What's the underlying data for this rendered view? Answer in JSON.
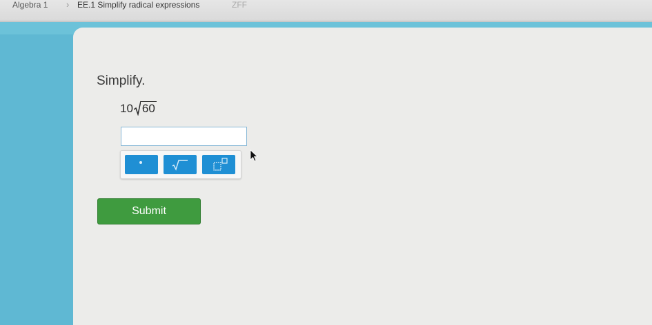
{
  "breadcrumb": {
    "subject": "Algebra 1",
    "skill": "EE.1 Simplify radical expressions",
    "code": "ZFF"
  },
  "question": {
    "title": "Simplify.",
    "coefficient": "10",
    "radicand": "60"
  },
  "answer": {
    "value": ""
  },
  "keypad": {
    "keys": [
      {
        "name": "decimal-point",
        "icon": "dot-icon"
      },
      {
        "name": "square-root",
        "icon": "square-root-icon"
      },
      {
        "name": "exponent",
        "icon": "exponent-icon"
      }
    ],
    "key_color": "#1f8fd4"
  },
  "actions": {
    "submit_label": "Submit",
    "submit_color": "#3f9b3f"
  },
  "colors": {
    "background": "#5fb8d3",
    "card": "#ececea"
  }
}
